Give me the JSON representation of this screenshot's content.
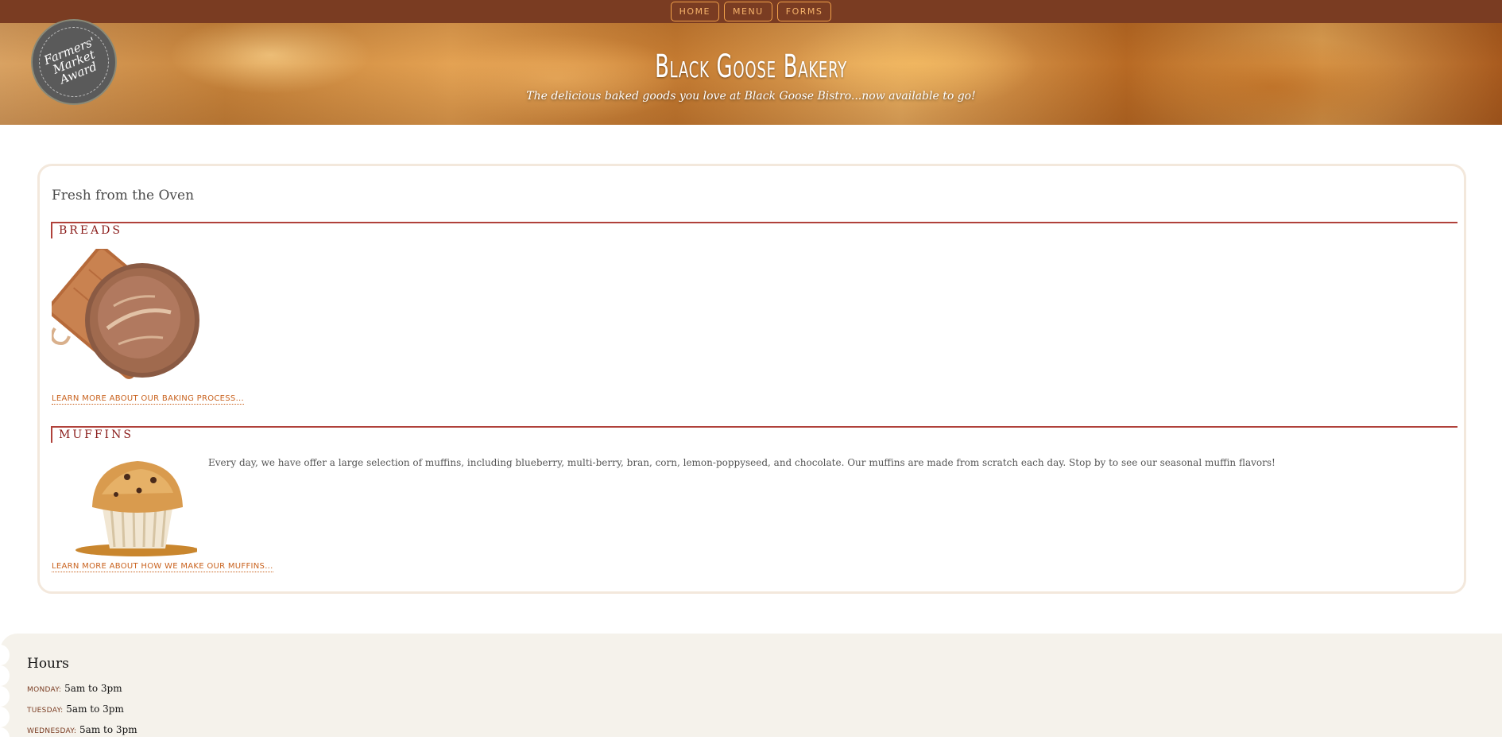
{
  "nav": {
    "items": [
      {
        "label": "HOME"
      },
      {
        "label": "MENU"
      },
      {
        "label": "FORMS"
      }
    ]
  },
  "header": {
    "title": "Black Goose Bakery",
    "tagline": "The delicious baked goods you love at Black Goose Bistro...now available to go!",
    "badge_text": "Farmers' Market Award"
  },
  "main": {
    "title": "Fresh from the Oven",
    "breads": {
      "heading": "BREADS",
      "link": "LEARN MORE ABOUT OUR BAKING PROCESS..."
    },
    "muffins": {
      "heading": "MUFFINS",
      "text": "Every day, we have offer a large selection of muffins, including blueberry, multi-berry, bran, corn, lemon-poppyseed, and chocolate. Our muffins are made from scratch each day. Stop by to see our seasonal muffin flavors!",
      "link": "LEARN MORE ABOUT HOW WE MAKE OUR MUFFINS..."
    }
  },
  "hours": {
    "title": "Hours",
    "rows": [
      {
        "day": "MONDAY:",
        "time": "5am to 3pm"
      },
      {
        "day": "TUESDAY:",
        "time": "5am to 3pm"
      },
      {
        "day": "WEDNESDAY:",
        "time": "5am to 3pm"
      }
    ]
  },
  "colors": {
    "nav_bg": "#7a3c22",
    "accent": "#f0a04a",
    "section_rule": "#b0413a",
    "link": "#c9621e",
    "hours_bg": "#f5f2eb"
  }
}
